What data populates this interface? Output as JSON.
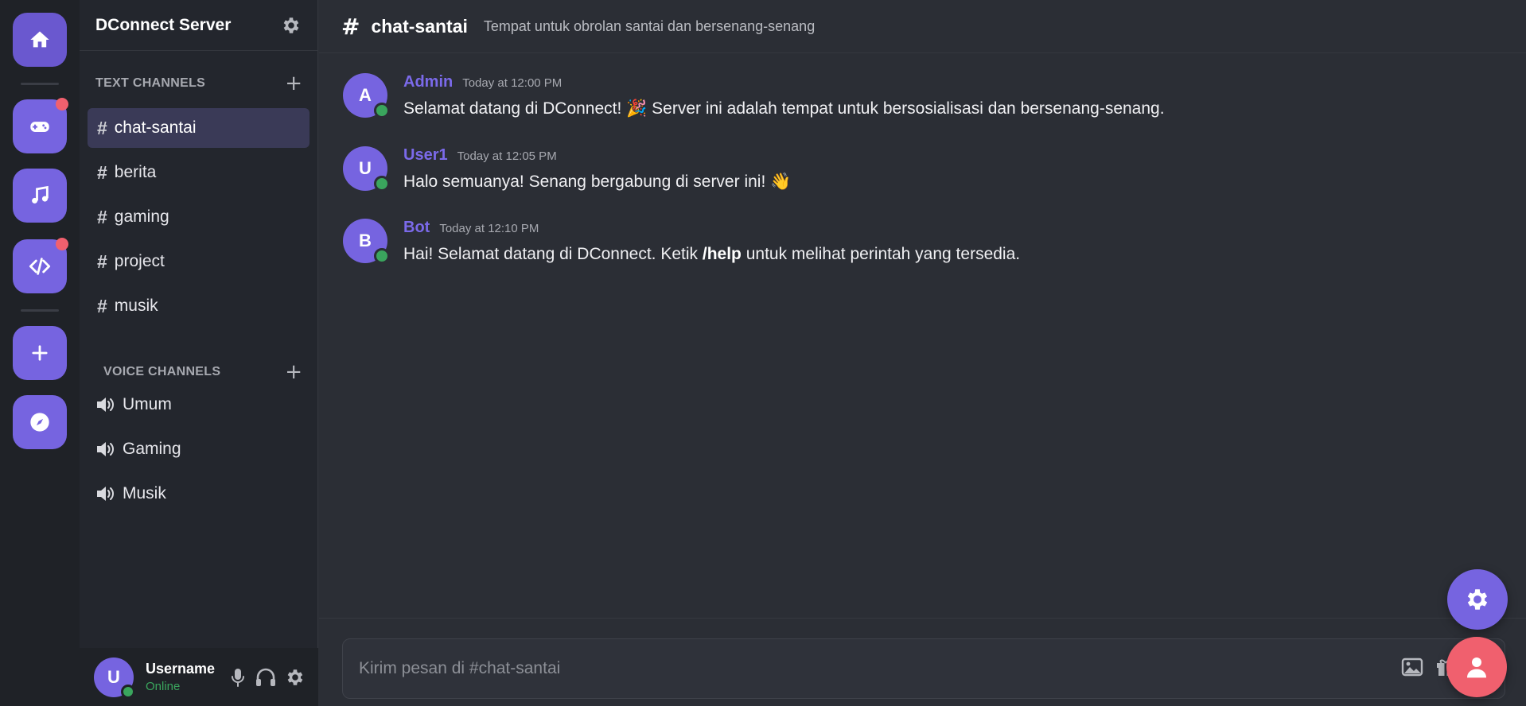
{
  "colors": {
    "accent": "#7664e0",
    "online": "#3aa55d",
    "badge": "#f0606e",
    "rail_bg": "#1f2227",
    "sidebar_bg": "#23262d",
    "main_bg": "#2b2e35"
  },
  "servers": [
    {
      "icon": "home-icon"
    },
    {
      "icon": "gamepad-icon",
      "has_badge": true
    },
    {
      "icon": "music-note-icon"
    },
    {
      "icon": "code-icon",
      "has_badge": true
    },
    {
      "icon": "plus-icon"
    },
    {
      "icon": "compass-icon"
    }
  ],
  "sidebar": {
    "server_name": "DConnect Server",
    "text_category": "TEXT CHANNELS",
    "text_channels": [
      "chat-santai",
      "berita",
      "gaming",
      "project",
      "musik"
    ],
    "active_channel": "chat-santai",
    "voice_category": "VOICE CHANNELS",
    "voice_channels": [
      "Umum",
      "Gaming",
      "Musik"
    ]
  },
  "user_panel": {
    "avatar_letter": "U",
    "username": "Username",
    "status": "Online"
  },
  "header": {
    "hash": "#",
    "channel": "chat-santai",
    "topic": "Tempat untuk obrolan santai dan bersenang-senang"
  },
  "messages": [
    {
      "avatar": "A",
      "author": "Admin",
      "time": "Today at 12:00 PM",
      "text": "Selamat datang di DConnect! 🎉 Server ini adalah tempat untuk bersosialisasi dan bersenang-senang."
    },
    {
      "avatar": "U",
      "author": "User1",
      "time": "Today at 12:05 PM",
      "text": "Halo semuanya! Senang bergabung di server ini! 👋"
    },
    {
      "avatar": "B",
      "author": "Bot",
      "time": "Today at 12:10 PM",
      "text_before": "Hai! Selamat datang di DConnect. Ketik ",
      "text_bold": "/help",
      "text_after": " untuk melihat perintah yang tersedia."
    }
  ],
  "composer": {
    "placeholder": "Kirim pesan di #chat-santai"
  }
}
